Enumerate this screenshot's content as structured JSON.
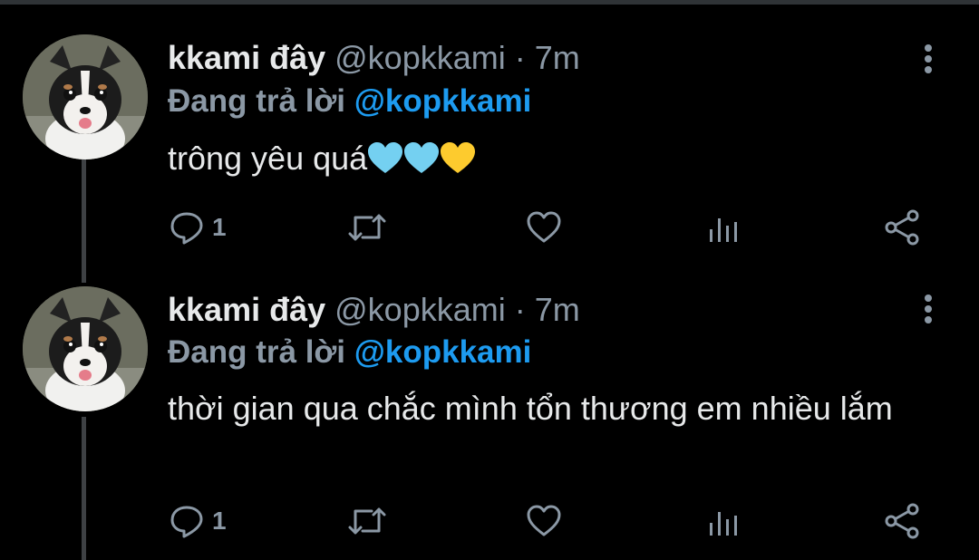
{
  "tweets": [
    {
      "name": "kkami đây",
      "handle": "@kopkkami",
      "separator": "·",
      "time": "7m",
      "reply_prefix": "Đang trả lời",
      "reply_to": "@kopkkami",
      "text": "trông yêu quá",
      "emojis": [
        "light-blue-heart",
        "light-blue-heart",
        "yellow-heart"
      ],
      "reply_count": "1"
    },
    {
      "name": "kkami đây",
      "handle": "@kopkkami",
      "separator": "·",
      "time": "7m",
      "reply_prefix": "Đang trả lời",
      "reply_to": "@kopkkami",
      "text": "thời gian qua chắc mình tổn thương em nhiều lắm",
      "reply_count": "1"
    }
  ],
  "icons": [
    "more-vertical-icon",
    "reply-icon",
    "retweet-icon",
    "like-icon",
    "analytics-icon",
    "share-icon"
  ],
  "colors": {
    "background": "#000000",
    "accent": "#1d9bf0",
    "muted": "#8b98a5",
    "text": "#e7e9ea"
  }
}
